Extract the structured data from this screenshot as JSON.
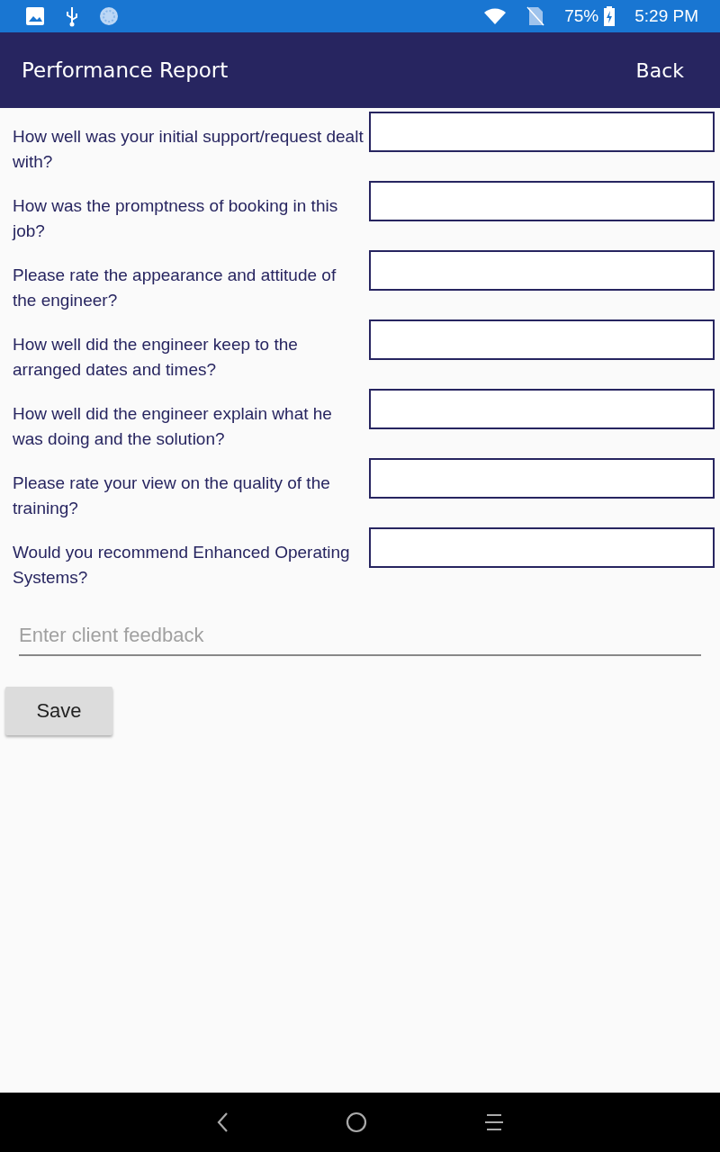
{
  "status_bar": {
    "battery": "75%",
    "time": "5:29 PM"
  },
  "header": {
    "title": "Performance Report",
    "back": "Back"
  },
  "questions": [
    {
      "label": "How well was your initial support/request dealt with?"
    },
    {
      "label": "How was the promptness of booking in this job?"
    },
    {
      "label": "Please rate the appearance and attitude of the engineer?"
    },
    {
      "label": "How well did the engineer keep to the arranged dates and times?"
    },
    {
      "label": "How well did the engineer explain what he was doing and the solution?"
    },
    {
      "label": "Please rate your view on the quality of the training?"
    },
    {
      "label": "Would you recommend Enhanced Operating Systems?"
    }
  ],
  "feedback": {
    "placeholder": "Enter client feedback"
  },
  "save_button": "Save"
}
